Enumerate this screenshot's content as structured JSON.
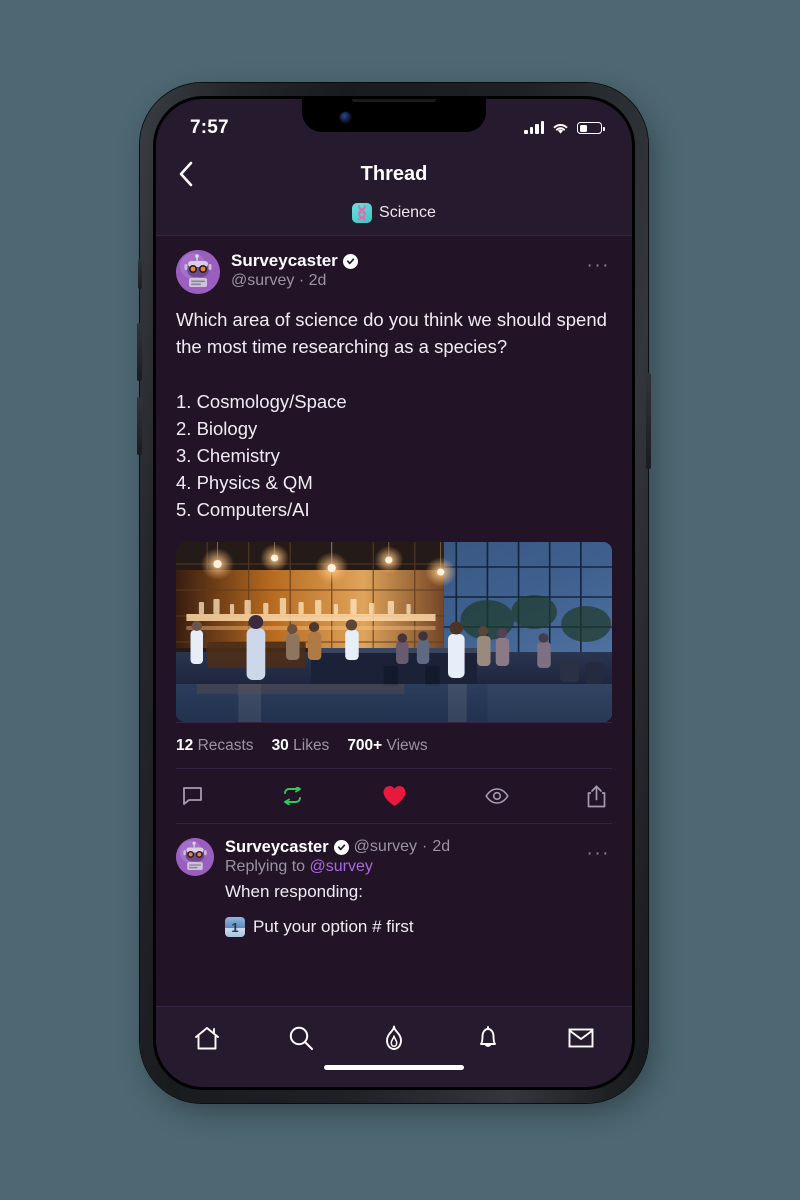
{
  "status_bar": {
    "time": "7:57",
    "signal_icon": "cellular-signal-icon",
    "wifi_icon": "wifi-icon",
    "battery_icon": "battery-icon",
    "battery_level_percent": 35
  },
  "header": {
    "back_icon": "back-chevron-icon",
    "title": "Thread",
    "channel": {
      "icon": "dna-helix-icon",
      "name": "Science"
    }
  },
  "post": {
    "author": {
      "display_name": "Surveycaster",
      "verified_icon": "verified-badge-icon",
      "handle": "@survey",
      "separator": "·",
      "timestamp": "2d",
      "handle_line": "@survey · 2d",
      "avatar_icon": "robot-avatar"
    },
    "more_menu": "···",
    "body": "Which area of science do you think we should spend the most time researching as a species?\n\n1. Cosmology/Space\n2. Biology\n3. Chemistry\n4. Physics & QM\n5. Computers/AI",
    "image_alt": "laboratory-interior-photo",
    "stats": [
      {
        "value": "12",
        "label": "Recasts"
      },
      {
        "value": "30",
        "label": "Likes"
      },
      {
        "value": "700+",
        "label": "Views"
      }
    ],
    "actions": [
      {
        "name": "reply-button",
        "icon": "comment-icon",
        "state": "default"
      },
      {
        "name": "recast-button",
        "icon": "recast-icon",
        "state": "active"
      },
      {
        "name": "like-button",
        "icon": "heart-icon",
        "state": "liked"
      },
      {
        "name": "views-button",
        "icon": "eye-icon",
        "state": "default"
      },
      {
        "name": "share-button",
        "icon": "share-icon",
        "state": "default"
      }
    ]
  },
  "reply": {
    "author": {
      "display_name": "Surveycaster",
      "verified_icon": "verified-badge-icon",
      "handle": "@survey",
      "separator": "·",
      "timestamp": "2d",
      "avatar_icon": "robot-avatar"
    },
    "more_menu": "···",
    "replying_to_prefix": "Replying to",
    "replying_to_handle": "@survey",
    "text": "When responding:",
    "bullet_number": "1",
    "bullet_text": "Put your option # first"
  },
  "bottom_nav": [
    {
      "name": "nav-home",
      "icon": "home-icon"
    },
    {
      "name": "nav-search",
      "icon": "search-icon"
    },
    {
      "name": "nav-trending",
      "icon": "flame-icon"
    },
    {
      "name": "nav-notifications",
      "icon": "bell-icon"
    },
    {
      "name": "nav-messages",
      "icon": "envelope-icon"
    }
  ],
  "colors": {
    "page_background": "#4d6873",
    "app_background": "#221426",
    "header_background": "#251a2e",
    "divider": "#332640",
    "text_primary": "#f0ecf2",
    "text_muted": "#9b93a3",
    "mention": "#a96ae0",
    "like_red": "#e8193c",
    "recast_green": "#2fc95e",
    "channel_teal": "#4fd0d0"
  }
}
